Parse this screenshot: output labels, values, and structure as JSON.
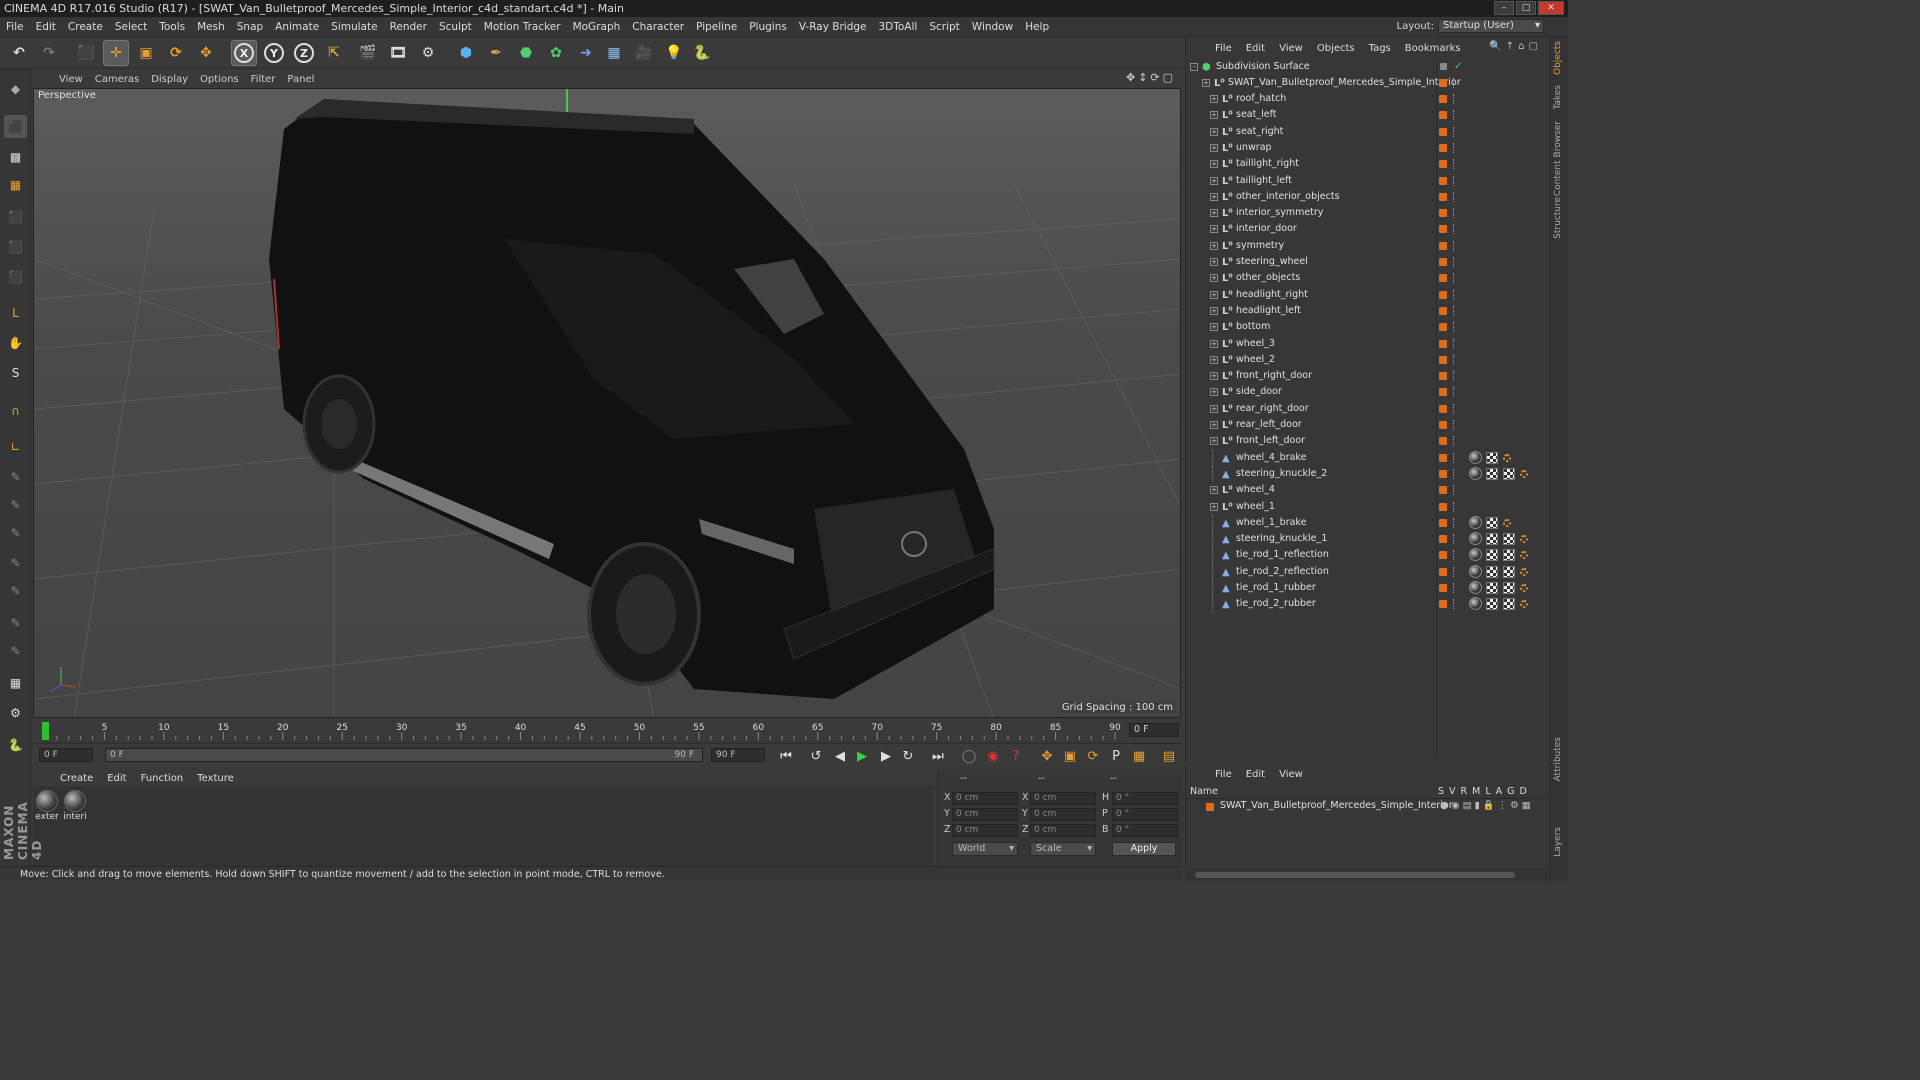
{
  "window": {
    "title": "CINEMA 4D R17.016 Studio (R17) - [SWAT_Van_Bulletproof_Mercedes_Simple_Interior_c4d_standart.c4d *] - Main"
  },
  "menubar": [
    "File",
    "Edit",
    "Create",
    "Select",
    "Tools",
    "Mesh",
    "Snap",
    "Animate",
    "Simulate",
    "Render",
    "Sculpt",
    "Motion Tracker",
    "MoGraph",
    "Character",
    "Pipeline",
    "Plugins",
    "V-Ray Bridge",
    "3DToAll",
    "Script",
    "Window",
    "Help"
  ],
  "layout": {
    "label": "Layout:",
    "value": "Startup (User)"
  },
  "toolbar": {
    "axis_x": "X",
    "axis_y": "Y",
    "axis_z": "Z"
  },
  "viewport": {
    "menu": [
      "View",
      "Cameras",
      "Display",
      "Options",
      "Filter",
      "Panel"
    ],
    "label": "Perspective",
    "grid_spacing": "Grid Spacing : 100 cm"
  },
  "timeline": {
    "ticks": [
      "0",
      "5",
      "10",
      "15",
      "20",
      "25",
      "30",
      "35",
      "40",
      "45",
      "50",
      "55",
      "60",
      "65",
      "70",
      "75",
      "80",
      "85",
      "90"
    ],
    "current_frame": "0 F",
    "start_field": "0 F",
    "range_start": "0 F",
    "range_end": "90 F",
    "end_field": "90 F"
  },
  "materials": {
    "menu": [
      "Create",
      "Edit",
      "Function",
      "Texture"
    ],
    "items": [
      {
        "label": "exter"
      },
      {
        "label": "interi"
      }
    ]
  },
  "coords": {
    "header": [
      "--",
      "--",
      "--"
    ],
    "pos_labels": [
      "X",
      "Y",
      "Z"
    ],
    "size_labels": [
      "X",
      "Y",
      "Z"
    ],
    "rot_labels": [
      "H",
      "P",
      "B"
    ],
    "pos_values": [
      "0 cm",
      "0 cm",
      "0 cm"
    ],
    "size_values": [
      "0 cm",
      "0 cm",
      "0 cm"
    ],
    "rot_values": [
      "0 °",
      "0 °",
      "0 °"
    ],
    "mode": "World",
    "size_mode": "Scale",
    "apply": "Apply"
  },
  "status": "Move: Click and drag to move elements. Hold down SHIFT to quantize movement / add to the selection in point mode, CTRL to remove.",
  "brand": "MAXON CINEMA 4D",
  "objects": {
    "menu": [
      "File",
      "Edit",
      "View",
      "Objects",
      "Tags",
      "Bookmarks"
    ],
    "root": "Subdivision Surface",
    "parent": "SWAT_Van_Bulletproof_Mercedes_Simple_Interior",
    "children": [
      {
        "name": "roof_hatch",
        "type": "null",
        "tags": []
      },
      {
        "name": "seat_left",
        "type": "null",
        "tags": []
      },
      {
        "name": "seat_right",
        "type": "null",
        "tags": []
      },
      {
        "name": "unwrap",
        "type": "null",
        "tags": []
      },
      {
        "name": "taillight_right",
        "type": "null",
        "tags": []
      },
      {
        "name": "taillight_left",
        "type": "null",
        "tags": []
      },
      {
        "name": "other_interior_objects",
        "type": "null",
        "tags": []
      },
      {
        "name": "interior_symmetry",
        "type": "null",
        "tags": []
      },
      {
        "name": "interior_door",
        "type": "null",
        "tags": []
      },
      {
        "name": "symmetry",
        "type": "null",
        "tags": []
      },
      {
        "name": "steering_wheel",
        "type": "null",
        "tags": []
      },
      {
        "name": "other_objects",
        "type": "null",
        "tags": []
      },
      {
        "name": "headlight_right",
        "type": "null",
        "tags": []
      },
      {
        "name": "headlight_left",
        "type": "null",
        "tags": []
      },
      {
        "name": "bottom",
        "type": "null",
        "tags": []
      },
      {
        "name": "wheel_3",
        "type": "null",
        "tags": []
      },
      {
        "name": "wheel_2",
        "type": "null",
        "tags": []
      },
      {
        "name": "front_right_door",
        "type": "null",
        "tags": []
      },
      {
        "name": "side_door",
        "type": "null",
        "tags": []
      },
      {
        "name": "rear_right_door",
        "type": "null",
        "tags": []
      },
      {
        "name": "rear_left_door",
        "type": "null",
        "tags": []
      },
      {
        "name": "front_left_door",
        "type": "null",
        "tags": []
      },
      {
        "name": "wheel_4_brake",
        "type": "mesh",
        "tags": [
          "material",
          "checker",
          "uvw"
        ]
      },
      {
        "name": "steering_knuckle_2",
        "type": "mesh",
        "tags": [
          "material",
          "checker",
          "checker",
          "uvw"
        ]
      },
      {
        "name": "wheel_4",
        "type": "null",
        "tags": []
      },
      {
        "name": "wheel_1",
        "type": "null",
        "tags": []
      },
      {
        "name": "wheel_1_brake",
        "type": "mesh",
        "tags": [
          "material",
          "checker",
          "uvw"
        ]
      },
      {
        "name": "steering_knuckle_1",
        "type": "mesh",
        "tags": [
          "material",
          "checker",
          "checker",
          "uvw"
        ]
      },
      {
        "name": "tie_rod_1_reflection",
        "type": "mesh",
        "tags": [
          "material",
          "checker",
          "checker",
          "uvw"
        ]
      },
      {
        "name": "tie_rod_2_reflection",
        "type": "mesh",
        "tags": [
          "material",
          "checker",
          "checker",
          "uvw"
        ]
      },
      {
        "name": "tie_rod_1_rubber",
        "type": "mesh",
        "tags": [
          "material",
          "checker",
          "checker",
          "uvw"
        ]
      },
      {
        "name": "tie_rod_2_rubber",
        "type": "mesh",
        "tags": [
          "material",
          "checker",
          "checker",
          "uvw"
        ]
      }
    ]
  },
  "layers": {
    "menu": [
      "File",
      "Edit",
      "View"
    ],
    "header_name": "Name",
    "header_flags": [
      "S",
      "V",
      "R",
      "M",
      "L",
      "A",
      "G",
      "D"
    ],
    "rows": [
      {
        "name": "SWAT_Van_Bulletproof_Mercedes_Simple_Interior"
      }
    ]
  },
  "right_tabs": [
    "Objects",
    "Takes",
    "Content Browser",
    "Structure",
    "Attributes",
    "Layers"
  ],
  "colors": {
    "accent_orange": "#e06b1a",
    "selection": "#5a5a5a",
    "bg": "#3a3a3a"
  }
}
